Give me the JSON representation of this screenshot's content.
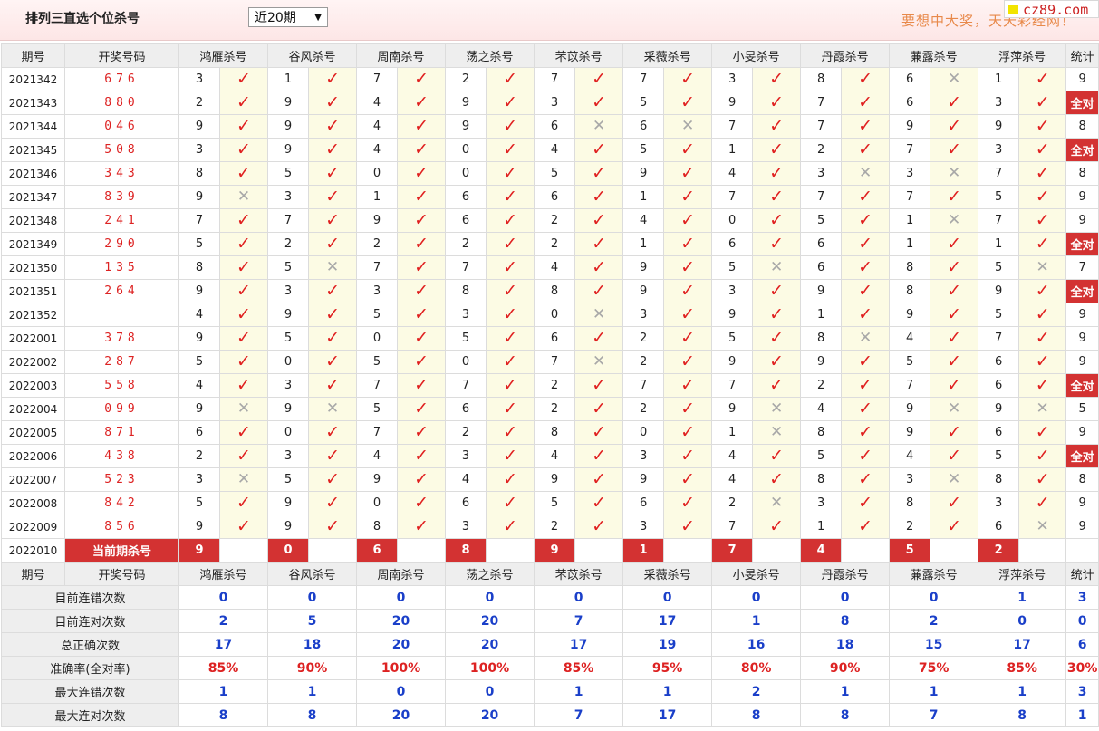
{
  "header": {
    "title": "排列三直选个位杀号",
    "period_selected": "近20期",
    "slogan": "要想中大奖，天天彩经网！",
    "site": "cz89.com"
  },
  "columns": {
    "issue": "期号",
    "number": "开奖号码",
    "stat": "统计",
    "experts": [
      "鸿雁杀号",
      "谷风杀号",
      "周南杀号",
      "荡之杀号",
      "芣苡杀号",
      "采薇杀号",
      "小旻杀号",
      "丹霞杀号",
      "蒹露杀号",
      "浮萍杀号"
    ]
  },
  "rows": [
    {
      "issue": "2021342",
      "number": "676",
      "kills": [
        3,
        1,
        7,
        2,
        7,
        7,
        3,
        8,
        6,
        1
      ],
      "ok": [
        1,
        1,
        1,
        1,
        1,
        1,
        1,
        1,
        0,
        1
      ],
      "stat": "9"
    },
    {
      "issue": "2021343",
      "number": "880",
      "kills": [
        2,
        9,
        4,
        9,
        3,
        5,
        9,
        7,
        6,
        3
      ],
      "ok": [
        1,
        1,
        1,
        1,
        1,
        1,
        1,
        1,
        1,
        1
      ],
      "stat": "全对"
    },
    {
      "issue": "2021344",
      "number": "046",
      "kills": [
        9,
        9,
        4,
        9,
        6,
        6,
        7,
        7,
        9,
        9
      ],
      "ok": [
        1,
        1,
        1,
        1,
        0,
        0,
        1,
        1,
        1,
        1
      ],
      "stat": "8"
    },
    {
      "issue": "2021345",
      "number": "508",
      "kills": [
        3,
        9,
        4,
        0,
        4,
        5,
        1,
        2,
        7,
        3
      ],
      "ok": [
        1,
        1,
        1,
        1,
        1,
        1,
        1,
        1,
        1,
        1
      ],
      "stat": "全对"
    },
    {
      "issue": "2021346",
      "number": "343",
      "kills": [
        8,
        5,
        0,
        0,
        5,
        9,
        4,
        3,
        3,
        7
      ],
      "ok": [
        1,
        1,
        1,
        1,
        1,
        1,
        1,
        0,
        0,
        1
      ],
      "stat": "8"
    },
    {
      "issue": "2021347",
      "number": "839",
      "kills": [
        9,
        3,
        1,
        6,
        6,
        1,
        7,
        7,
        7,
        5
      ],
      "ok": [
        0,
        1,
        1,
        1,
        1,
        1,
        1,
        1,
        1,
        1
      ],
      "stat": "9"
    },
    {
      "issue": "2021348",
      "number": "241",
      "kills": [
        7,
        7,
        9,
        6,
        2,
        4,
        0,
        5,
        1,
        7
      ],
      "ok": [
        1,
        1,
        1,
        1,
        1,
        1,
        1,
        1,
        0,
        1
      ],
      "stat": "9"
    },
    {
      "issue": "2021349",
      "number": "290",
      "kills": [
        5,
        2,
        2,
        2,
        2,
        1,
        6,
        6,
        1,
        1
      ],
      "ok": [
        1,
        1,
        1,
        1,
        1,
        1,
        1,
        1,
        1,
        1
      ],
      "stat": "全对"
    },
    {
      "issue": "2021350",
      "number": "135",
      "kills": [
        8,
        5,
        7,
        7,
        4,
        9,
        5,
        6,
        8,
        5
      ],
      "ok": [
        1,
        0,
        1,
        1,
        1,
        1,
        0,
        1,
        1,
        0
      ],
      "stat": "7"
    },
    {
      "issue": "2021351",
      "number": "264",
      "kills": [
        9,
        3,
        3,
        8,
        8,
        9,
        3,
        9,
        8,
        9
      ],
      "ok": [
        1,
        1,
        1,
        1,
        1,
        1,
        1,
        1,
        1,
        1
      ],
      "stat": "全对"
    },
    {
      "issue": "2021352",
      "number": "",
      "kills": [
        4,
        9,
        5,
        3,
        0,
        3,
        9,
        1,
        9,
        5
      ],
      "ok": [
        1,
        1,
        1,
        1,
        0,
        1,
        1,
        1,
        1,
        1
      ],
      "stat": "9"
    },
    {
      "issue": "2022001",
      "number": "378",
      "kills": [
        9,
        5,
        0,
        5,
        6,
        2,
        5,
        8,
        4,
        7
      ],
      "ok": [
        1,
        1,
        1,
        1,
        1,
        1,
        1,
        0,
        1,
        1
      ],
      "stat": "9"
    },
    {
      "issue": "2022002",
      "number": "287",
      "kills": [
        5,
        0,
        5,
        0,
        7,
        2,
        9,
        9,
        5,
        6
      ],
      "ok": [
        1,
        1,
        1,
        1,
        0,
        1,
        1,
        1,
        1,
        1
      ],
      "stat": "9"
    },
    {
      "issue": "2022003",
      "number": "558",
      "kills": [
        4,
        3,
        7,
        7,
        2,
        7,
        7,
        2,
        7,
        6
      ],
      "ok": [
        1,
        1,
        1,
        1,
        1,
        1,
        1,
        1,
        1,
        1
      ],
      "stat": "全对"
    },
    {
      "issue": "2022004",
      "number": "099",
      "kills": [
        9,
        9,
        5,
        6,
        2,
        2,
        9,
        4,
        9,
        9
      ],
      "ok": [
        0,
        0,
        1,
        1,
        1,
        1,
        0,
        1,
        0,
        0
      ],
      "stat": "5"
    },
    {
      "issue": "2022005",
      "number": "871",
      "kills": [
        6,
        0,
        7,
        2,
        8,
        0,
        1,
        8,
        9,
        6
      ],
      "ok": [
        1,
        1,
        1,
        1,
        1,
        1,
        0,
        1,
        1,
        1
      ],
      "stat": "9"
    },
    {
      "issue": "2022006",
      "number": "438",
      "kills": [
        2,
        3,
        4,
        3,
        4,
        3,
        4,
        5,
        4,
        5
      ],
      "ok": [
        1,
        1,
        1,
        1,
        1,
        1,
        1,
        1,
        1,
        1
      ],
      "stat": "全对"
    },
    {
      "issue": "2022007",
      "number": "523",
      "kills": [
        3,
        5,
        9,
        4,
        9,
        9,
        4,
        8,
        3,
        8
      ],
      "ok": [
        0,
        1,
        1,
        1,
        1,
        1,
        1,
        1,
        0,
        1
      ],
      "stat": "8"
    },
    {
      "issue": "2022008",
      "number": "842",
      "kills": [
        5,
        9,
        0,
        6,
        5,
        6,
        2,
        3,
        8,
        3
      ],
      "ok": [
        1,
        1,
        1,
        1,
        1,
        1,
        0,
        1,
        1,
        1
      ],
      "stat": "9"
    },
    {
      "issue": "2022009",
      "number": "856",
      "kills": [
        9,
        9,
        8,
        3,
        2,
        3,
        7,
        1,
        2,
        6
      ],
      "ok": [
        1,
        1,
        1,
        1,
        1,
        1,
        1,
        1,
        1,
        0
      ],
      "stat": "9"
    }
  ],
  "current": {
    "issue": "2022010",
    "label": "当前期杀号",
    "kills": [
      "9",
      "0",
      "6",
      "8",
      "9",
      "1",
      "7",
      "4",
      "5",
      "2"
    ]
  },
  "summary": [
    {
      "label": "目前连错次数",
      "values": [
        "0",
        "0",
        "0",
        "0",
        "0",
        "0",
        "0",
        "0",
        "0",
        "1"
      ],
      "stat": "3"
    },
    {
      "label": "目前连对次数",
      "values": [
        "2",
        "5",
        "20",
        "20",
        "7",
        "17",
        "1",
        "8",
        "2",
        "0"
      ],
      "stat": "0"
    },
    {
      "label": "总正确次数",
      "values": [
        "17",
        "18",
        "20",
        "20",
        "17",
        "19",
        "16",
        "18",
        "15",
        "17"
      ],
      "stat": "6"
    },
    {
      "label": "准确率(全对率)",
      "values": [
        "85%",
        "90%",
        "100%",
        "100%",
        "85%",
        "95%",
        "80%",
        "90%",
        "75%",
        "85%"
      ],
      "stat": "30%",
      "rate": true
    },
    {
      "label": "最大连错次数",
      "values": [
        "1",
        "1",
        "0",
        "0",
        "1",
        "1",
        "2",
        "1",
        "1",
        "1"
      ],
      "stat": "3"
    },
    {
      "label": "最大连对次数",
      "values": [
        "8",
        "8",
        "20",
        "20",
        "7",
        "17",
        "8",
        "8",
        "7",
        "8"
      ],
      "stat": "1"
    }
  ]
}
